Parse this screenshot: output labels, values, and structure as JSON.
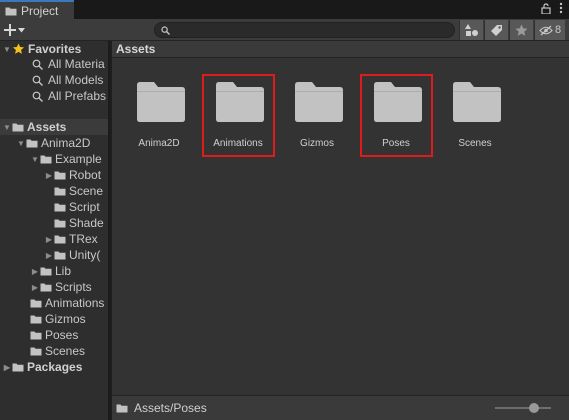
{
  "tab": {
    "title": "Project",
    "item_count": "8"
  },
  "search": {
    "placeholder": ""
  },
  "tree": {
    "favorites": {
      "label": "Favorites",
      "items": [
        "All Materia",
        "All Models",
        "All Prefabs"
      ]
    },
    "assets": {
      "label": "Assets",
      "anima2d": "Anima2D",
      "examples": "Example",
      "example_children": [
        "Robot",
        "Scene",
        "Script",
        "Shade",
        "TRex",
        "Unity("
      ],
      "anima2d_children": [
        "Lib",
        "Scripts"
      ],
      "folders": [
        "Animations",
        "Gizmos",
        "Poses",
        "Scenes"
      ]
    },
    "packages": "Packages"
  },
  "breadcrumb": "Assets",
  "grid": {
    "items": [
      "Anima2D",
      "Animations",
      "Gizmos",
      "Poses",
      "Scenes"
    ],
    "highlighted": [
      "Animations",
      "Poses"
    ]
  },
  "status": {
    "path": "Assets/Poses",
    "zoom": 0.7
  },
  "colors": {
    "highlight": "#e01b1b",
    "folder": "#c2c2c2",
    "accent": "#3a79bb"
  }
}
